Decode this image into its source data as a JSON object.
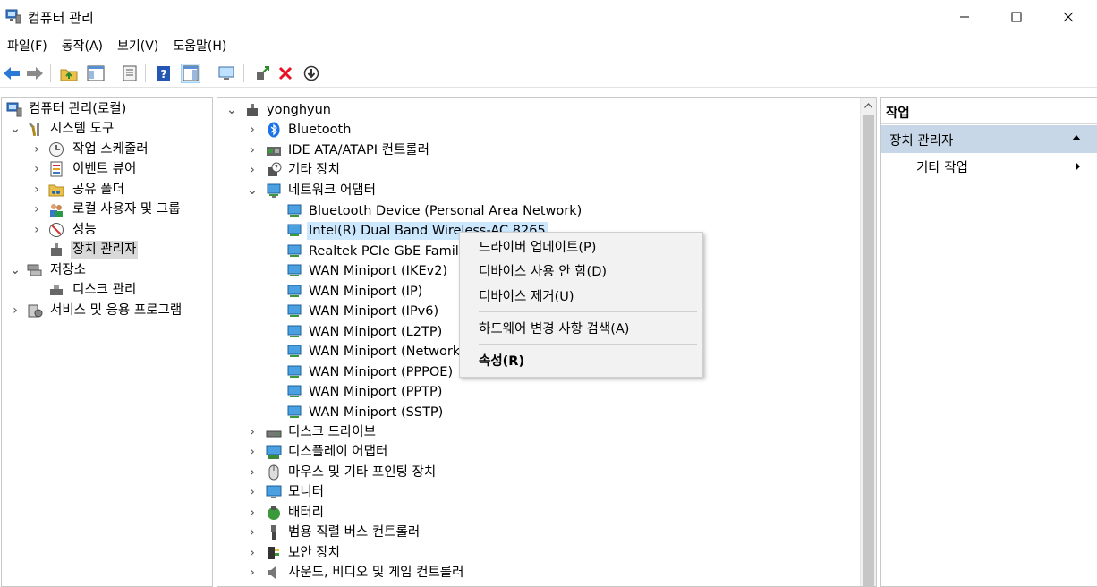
{
  "window": {
    "title": "컴퓨터 관리",
    "controls": {
      "minimize": "—",
      "maximize": "☐",
      "close": "✕"
    }
  },
  "menu": [
    {
      "label": "파일(F)"
    },
    {
      "label": "동작(A)"
    },
    {
      "label": "보기(V)"
    },
    {
      "label": "도움말(H)"
    }
  ],
  "toolbar": {
    "icons": [
      "back-arrow-icon",
      "forward-arrow-icon",
      "up-folder-icon",
      "show-hide-tree-icon",
      "properties-icon",
      "help-icon",
      "action-pane-icon",
      "monitor-icon",
      "update-driver-icon",
      "uninstall-icon",
      "disable-device-icon"
    ]
  },
  "left_tree": {
    "root": "컴퓨터 관리(로컬)",
    "items": [
      {
        "label": "시스템 도구"
      },
      {
        "label": "작업 스케줄러"
      },
      {
        "label": "이벤트 뷰어"
      },
      {
        "label": "공유 폴더"
      },
      {
        "label": "로컬 사용자 및 그룹"
      },
      {
        "label": "성능"
      },
      {
        "label": "장치 관리자"
      },
      {
        "label": "저장소"
      },
      {
        "label": "디스크 관리"
      },
      {
        "label": "서비스 및 응용 프로그램"
      }
    ]
  },
  "device_tree": {
    "root": "yonghyun",
    "categories": [
      {
        "label": "Bluetooth"
      },
      {
        "label": "IDE ATA/ATAPI 컨트롤러"
      },
      {
        "label": "기타 장치"
      },
      {
        "label": "네트워크 어댑터"
      }
    ],
    "network_adapters": [
      {
        "label": "Bluetooth Device (Personal Area Network)"
      },
      {
        "label": "Intel(R) Dual Band Wireless-AC 8265"
      },
      {
        "label": "Realtek PCIe GbE Family Controller"
      },
      {
        "label": "WAN Miniport (IKEv2)"
      },
      {
        "label": "WAN Miniport (IP)"
      },
      {
        "label": "WAN Miniport (IPv6)"
      },
      {
        "label": "WAN Miniport (L2TP)"
      },
      {
        "label": "WAN Miniport (Network Monitor)"
      },
      {
        "label": "WAN Miniport (PPPOE)"
      },
      {
        "label": "WAN Miniport (PPTP)"
      },
      {
        "label": "WAN Miniport (SSTP)"
      }
    ],
    "more_categories": [
      {
        "label": "디스크 드라이브"
      },
      {
        "label": "디스플레이 어댑터"
      },
      {
        "label": "마우스 및 기타 포인팅 장치"
      },
      {
        "label": "모니터"
      },
      {
        "label": "배터리"
      },
      {
        "label": "범용 직렬 버스 컨트롤러"
      },
      {
        "label": "보안 장치"
      },
      {
        "label": "사운드, 비디오 및 게임 컨트롤러"
      }
    ]
  },
  "context_menu": {
    "items": [
      {
        "label": "드라이버 업데이트(P)"
      },
      {
        "label": "디바이스 사용 안 함(D)"
      },
      {
        "label": "디바이스 제거(U)"
      },
      {
        "label": "하드웨어 변경 사항 검색(A)"
      },
      {
        "label": "속성(R)"
      }
    ]
  },
  "actions_pane": {
    "header": "작업",
    "section": "장치 관리자",
    "item": "기타 작업"
  },
  "colors": {
    "selection_bg": "#d9d9d9",
    "hover_bg": "#cce8ff",
    "actions_section_bg": "#c7d7e8",
    "close_red": "#e81123",
    "bluetooth_blue": "#1a73e8"
  }
}
